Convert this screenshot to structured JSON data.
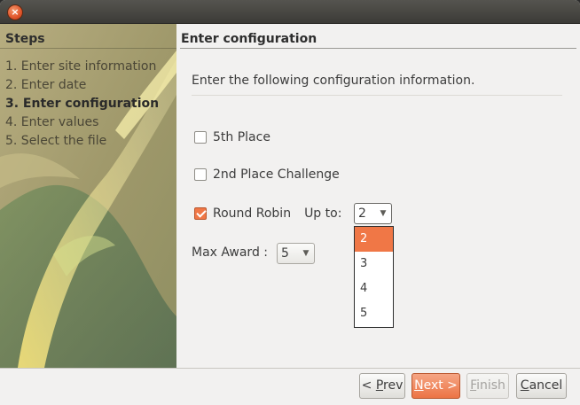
{
  "window": {
    "close_glyph": "×"
  },
  "sidebar": {
    "header": "Steps",
    "steps": [
      {
        "label": "1. Enter site information",
        "active": false
      },
      {
        "label": "2. Enter date",
        "active": false
      },
      {
        "label": "3. Enter configuration",
        "active": true
      },
      {
        "label": "4. Enter values",
        "active": false
      },
      {
        "label": "5. Select the file",
        "active": false
      }
    ]
  },
  "main": {
    "title": "Enter configuration",
    "intro": "Enter the following configuration information.",
    "options": [
      {
        "label": "5th Place",
        "checked": false
      },
      {
        "label": "2nd Place Challenge",
        "checked": false
      },
      {
        "label": "Round Robin",
        "checked": true
      }
    ],
    "round_robin": {
      "up_to_label": "Up to:",
      "selected": "2",
      "dropdown_options": [
        "2",
        "3",
        "4",
        "5"
      ],
      "highlighted": "2"
    },
    "max_award": {
      "label": "Max Award :",
      "selected": "5"
    }
  },
  "footer": {
    "prev": {
      "pre": "< ",
      "mnemonic": "P",
      "rest": "rev"
    },
    "next": {
      "mnemonic": "N",
      "rest": "ext >"
    },
    "finish": {
      "mnemonic": "F",
      "rest": "inish"
    },
    "cancel": {
      "mnemonic": "C",
      "rest": "ancel"
    }
  },
  "colors": {
    "accent": "#f07746",
    "sidebar": "#a59a6c"
  }
}
